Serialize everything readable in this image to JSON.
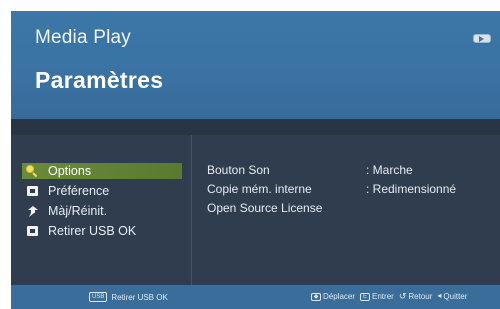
{
  "header": {
    "app_title": "Media Play",
    "page_title": "Paramètres",
    "media_icon": "media-card-icon"
  },
  "menu": {
    "items": [
      {
        "label": "Options",
        "icon": "search-icon",
        "selected": true
      },
      {
        "label": "Préférence",
        "icon": "preference-icon",
        "selected": false
      },
      {
        "label": "Màj/Réinit.",
        "icon": "update-icon",
        "selected": false
      },
      {
        "label": "Retirer USB OK",
        "icon": "usb-remove-icon",
        "selected": false
      }
    ]
  },
  "settings": {
    "rows": [
      {
        "label": "Bouton Son",
        "value": ": Marche"
      },
      {
        "label": "Copie mém. interne",
        "value": ": Redimensionné"
      },
      {
        "label": "Open Source License",
        "value": ""
      }
    ]
  },
  "footer": {
    "left_key": "USB",
    "left_label": "Retirer USB OK",
    "hints": [
      {
        "key": "◆",
        "label": "Déplacer"
      },
      {
        "key": "E",
        "label": "Entrer"
      },
      {
        "key": "↺",
        "label": "Retour"
      },
      {
        "key": "◂",
        "label": "Quitter"
      }
    ]
  },
  "colors": {
    "header_bg": "#3a72a3",
    "body_bg": "#2f3d4f",
    "selected_bg": "#6b8a3a",
    "footer_bg": "#3a6d9a"
  }
}
